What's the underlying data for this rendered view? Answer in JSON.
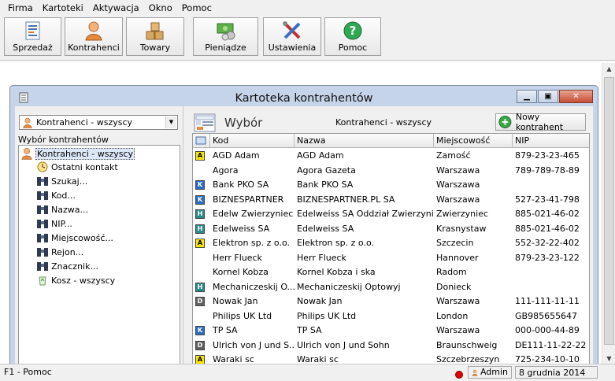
{
  "menu": [
    "Firma",
    "Kartoteki",
    "Aktywacja",
    "Okno",
    "Pomoc"
  ],
  "toolbar": [
    {
      "label": "Sprzedaż",
      "icon": "sales-document-icon"
    },
    {
      "label": "Kontrahenci",
      "icon": "person-icon"
    },
    {
      "label": "Towary",
      "icon": "boxes-icon"
    },
    {
      "label": "Pieniądze",
      "icon": "money-icon"
    },
    {
      "label": "Ustawienia",
      "icon": "tools-icon"
    },
    {
      "label": "Pomoc",
      "icon": "help-icon"
    }
  ],
  "window": {
    "title": "Kartoteka kontrahentów"
  },
  "left": {
    "combo_value": "Kontrahenci - wszyscy",
    "label": "Wybór kontrahentów",
    "tree": [
      {
        "label": "Kontrahenci - wszyscy",
        "icon": "person-icon"
      },
      {
        "label": "Ostatni kontakt",
        "icon": "clock-icon"
      },
      {
        "label": "Szukaj...",
        "icon": "binoculars-icon"
      },
      {
        "label": "Kod...",
        "icon": "binoculars-icon"
      },
      {
        "label": "Nazwa...",
        "icon": "binoculars-icon"
      },
      {
        "label": "NIP...",
        "icon": "binoculars-icon"
      },
      {
        "label": "Miejscowość...",
        "icon": "binoculars-icon"
      },
      {
        "label": "Rejon...",
        "icon": "binoculars-icon"
      },
      {
        "label": "Znacznik...",
        "icon": "binoculars-icon"
      },
      {
        "label": "Kosz - wszyscy",
        "icon": "recycle-bin-icon"
      }
    ]
  },
  "right": {
    "heading": "Wybór",
    "filter": "Kontrahenci - wszyscy",
    "new_button": "Nowy kontrahent",
    "columns": [
      "Kod",
      "Nazwa",
      "Miejscowość",
      "NIP"
    ],
    "rows": [
      {
        "badge": "A",
        "kod": "AGD Adam",
        "nazwa": "AGD Adam",
        "miejscowosc": "Zamość",
        "nip": "879-23-23-465"
      },
      {
        "badge": "",
        "kod": "Agora",
        "nazwa": "Agora Gazeta",
        "miejscowosc": "Warszawa",
        "nip": "789-789-78-89"
      },
      {
        "badge": "K",
        "kod": "Bank PKO SA",
        "nazwa": "Bank PKO SA",
        "miejscowosc": "Warszawa",
        "nip": ""
      },
      {
        "badge": "K",
        "kod": "BIZNESPARTNER",
        "nazwa": "BIZNESPARTNER.PL SA",
        "miejscowosc": "Warszawa",
        "nip": "527-23-41-798"
      },
      {
        "badge": "H",
        "kod": "Edelw Zwierzyniec",
        "nazwa": "Edelweiss SA Oddział Zwierzyniec",
        "miejscowosc": "Zwierzyniec",
        "nip": "885-021-46-02"
      },
      {
        "badge": "H",
        "kod": "Edelweiss SA",
        "nazwa": "Edelweiss SA",
        "miejscowosc": "Krasnystaw",
        "nip": "885-021-46-02"
      },
      {
        "badge": "A",
        "kod": "Elektron sp. z o.o.",
        "nazwa": "Elektron sp. z o.o.",
        "miejscowosc": "Szczecin",
        "nip": "552-32-22-402"
      },
      {
        "badge": "",
        "kod": "Herr Flueck",
        "nazwa": "Herr Flueck",
        "miejscowosc": "Hannover",
        "nip": "879-23-23-122"
      },
      {
        "badge": "",
        "kod": "Kornel Kobza",
        "nazwa": "Kornel Kobza i ska",
        "miejscowosc": "Radom",
        "nip": ""
      },
      {
        "badge": "H",
        "kod": "Mechaniczeskij O...",
        "nazwa": "Mechaniczeskij Optowyj",
        "miejscowosc": "Donieck",
        "nip": ""
      },
      {
        "badge": "D",
        "kod": "Nowak Jan",
        "nazwa": "Nowak Jan",
        "miejscowosc": "Warszawa",
        "nip": "111-111-11-11"
      },
      {
        "badge": "",
        "kod": "Philips UK Ltd",
        "nazwa": "Philips UK Ltd",
        "miejscowosc": "London",
        "nip": "GB985655647"
      },
      {
        "badge": "K",
        "kod": "TP SA",
        "nazwa": "TP SA",
        "miejscowosc": "Warszawa",
        "nip": "000-000-44-89"
      },
      {
        "badge": "D",
        "kod": "Ulrich von J und S...",
        "nazwa": "Ulrich von J und Sohn",
        "miejscowosc": "Braunschweig",
        "nip": "DE111-11-22-22"
      },
      {
        "badge": "A",
        "kod": "Waraki sc",
        "nazwa": "Waraki sc",
        "miejscowosc": "Szczebrzeszyn",
        "nip": "725-234-10-10"
      }
    ]
  },
  "status": {
    "help": "F1 - Pomoc",
    "user": "Admin",
    "date": "8 grudnia 2014"
  },
  "colors": {
    "badge_A": "#f7e600",
    "badge_K": "#2a6cc4",
    "badge_H": "#2a8a8a",
    "badge_D": "#606060"
  }
}
